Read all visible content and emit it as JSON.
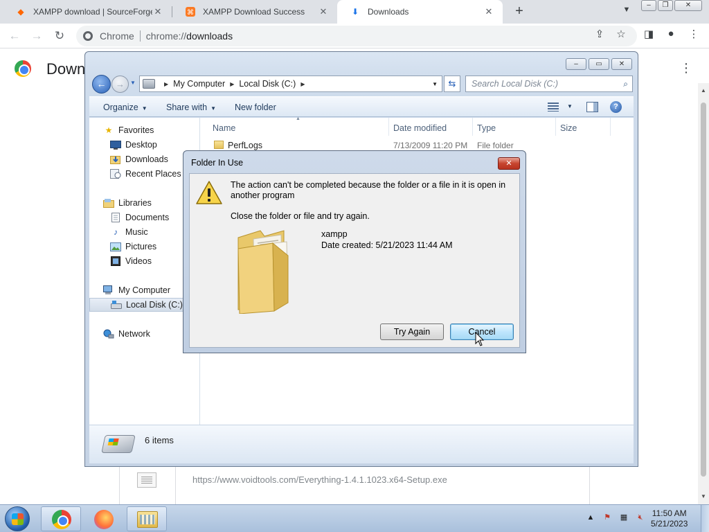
{
  "browser": {
    "tabs": [
      {
        "title": "XAMPP download | SourceForge",
        "icon": "sourceforge-icon"
      },
      {
        "title": "XAMPP Download Success",
        "icon": "xampp-icon"
      },
      {
        "title": "Downloads",
        "icon": "download-icon"
      }
    ],
    "chip_label": "Chrome",
    "url_scheme": "chrome://",
    "url_host": "downloads",
    "page_title": "Down",
    "download_item_url": "https://www.voidtools.com/Everything-1.4.1.1023.x64-Setup.exe"
  },
  "explorer": {
    "breadcrumbs": [
      "My Computer",
      "Local Disk (C:)"
    ],
    "search_placeholder": "Search Local Disk (C:)",
    "commands": [
      "Organize",
      "Share with",
      "New folder"
    ],
    "nav": {
      "favorites_label": "Favorites",
      "favorites": [
        "Desktop",
        "Downloads",
        "Recent Places"
      ],
      "libraries_label": "Libraries",
      "libraries": [
        "Documents",
        "Music",
        "Pictures",
        "Videos"
      ],
      "computer_label": "My Computer",
      "computer_children": [
        "Local Disk (C:)"
      ],
      "network_label": "Network"
    },
    "columns": [
      "Name",
      "Date modified",
      "Type",
      "Size"
    ],
    "files": [
      {
        "name": "PerfLogs",
        "date": "7/13/2009 11:20 PM",
        "type": "File folder"
      }
    ],
    "item_count": "6 items"
  },
  "dialog": {
    "title": "Folder In Use",
    "message": "The action can't be completed because the folder or a file in it is open in another program",
    "sub_message": "Close the folder or file and try again.",
    "file_name": "xampp",
    "date_created": "Date created: 5/21/2023 11:44 AM",
    "try_again_label": "Try Again",
    "cancel_label": "Cancel"
  },
  "taskbar": {
    "time": "11:50 AM",
    "date": "5/21/2023"
  },
  "colors": {
    "dialog_close": "#c7442f",
    "win7_accent": "#2a62b8"
  }
}
